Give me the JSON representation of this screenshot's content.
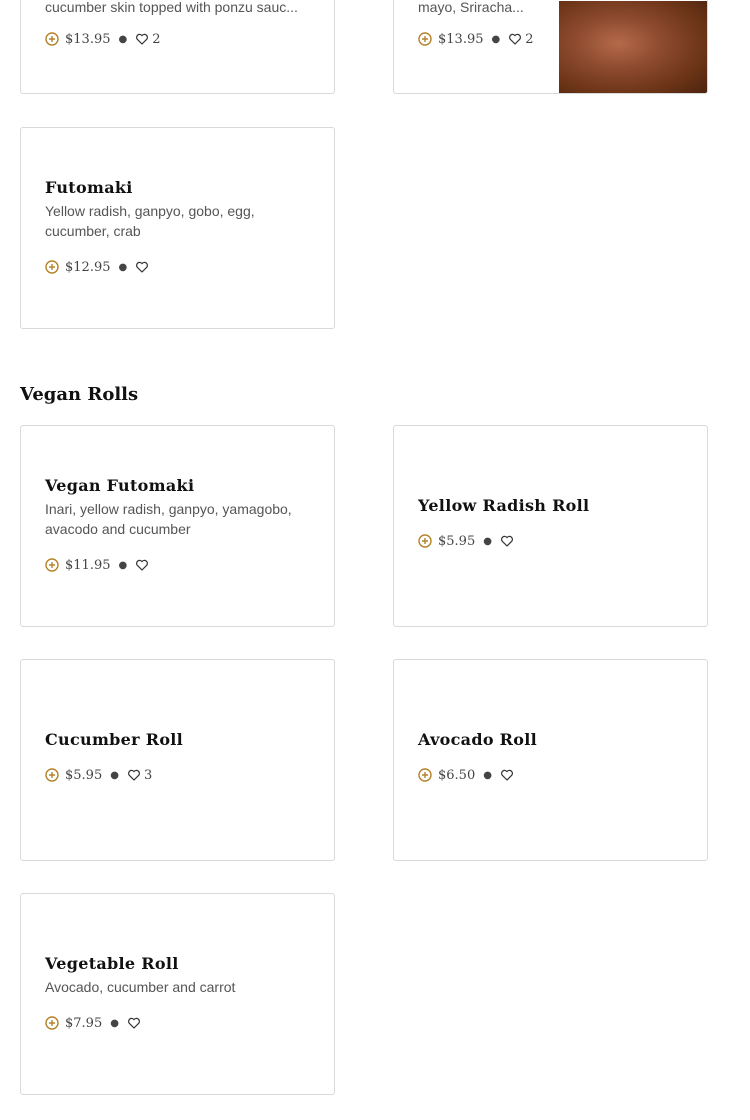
{
  "top_cards": [
    {
      "desc": "cucumber skin topped with ponzu sauc...",
      "price": "$13.95",
      "likes": "2"
    },
    {
      "desc": "mayo, Sriracha...",
      "price": "$13.95",
      "likes": "2"
    }
  ],
  "futomaki": {
    "title": "Futomaki",
    "desc": "Yellow radish, ganpyo, gobo, egg, cucumber, crab",
    "price": "$12.95",
    "likes": ""
  },
  "vegan_section": {
    "title": "Vegan Rolls",
    "items": [
      {
        "title": "Vegan Futomaki",
        "desc": "Inari, yellow radish, ganpyo, yamagobo, avacodo and cucumber",
        "price": "$11.95",
        "likes": ""
      },
      {
        "title": "Yellow Radish Roll",
        "desc": "",
        "price": "$5.95",
        "likes": ""
      },
      {
        "title": "Cucumber Roll",
        "desc": "",
        "price": "$5.95",
        "likes": "3"
      },
      {
        "title": "Avocado Roll",
        "desc": "",
        "price": "$6.50",
        "likes": ""
      },
      {
        "title": "Vegetable Roll",
        "desc": "Avocado, cucumber and carrot",
        "price": "$7.95",
        "likes": ""
      }
    ]
  },
  "icons": {
    "add": "plus-circle-icon",
    "like": "heart-icon"
  },
  "colors": {
    "accent": "#b5822a",
    "border": "#d9d9d9",
    "text": "#111111",
    "muted": "#555555"
  }
}
